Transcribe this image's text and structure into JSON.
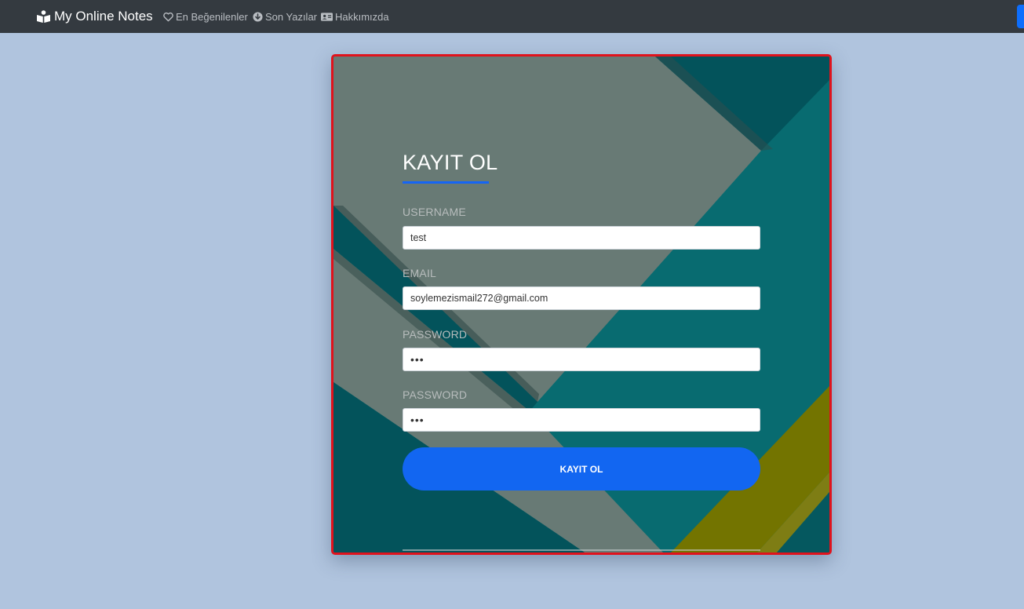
{
  "navbar": {
    "brand": "My Online Notes",
    "brand_icon": "book-reader-icon",
    "links": [
      {
        "label": "En Beğenilenler",
        "icon": "heart-icon"
      },
      {
        "label": "Son Yazılar",
        "icon": "arrow-circle-down-icon"
      },
      {
        "label": "Hakkımızda",
        "icon": "id-card-icon"
      }
    ]
  },
  "form": {
    "title": "KAYIT OL",
    "username_label": "USERNAME",
    "username_value": "test",
    "email_label": "EMAIL",
    "email_value": "soylemezismail272@gmail.com",
    "password_label": "PASSWORD",
    "password_value": "•••",
    "password_confirm_label": "PASSWORD",
    "password_confirm_value": "•••",
    "submit_label": "KAYIT OL"
  },
  "colors": {
    "page_bg": "#b0c4de",
    "navbar_bg": "#343a40",
    "accent_blue": "#1266f1",
    "card_border": "#e0121c",
    "teal": "#086b70",
    "gray_stripe": "#687a75",
    "olive": "#737400"
  }
}
